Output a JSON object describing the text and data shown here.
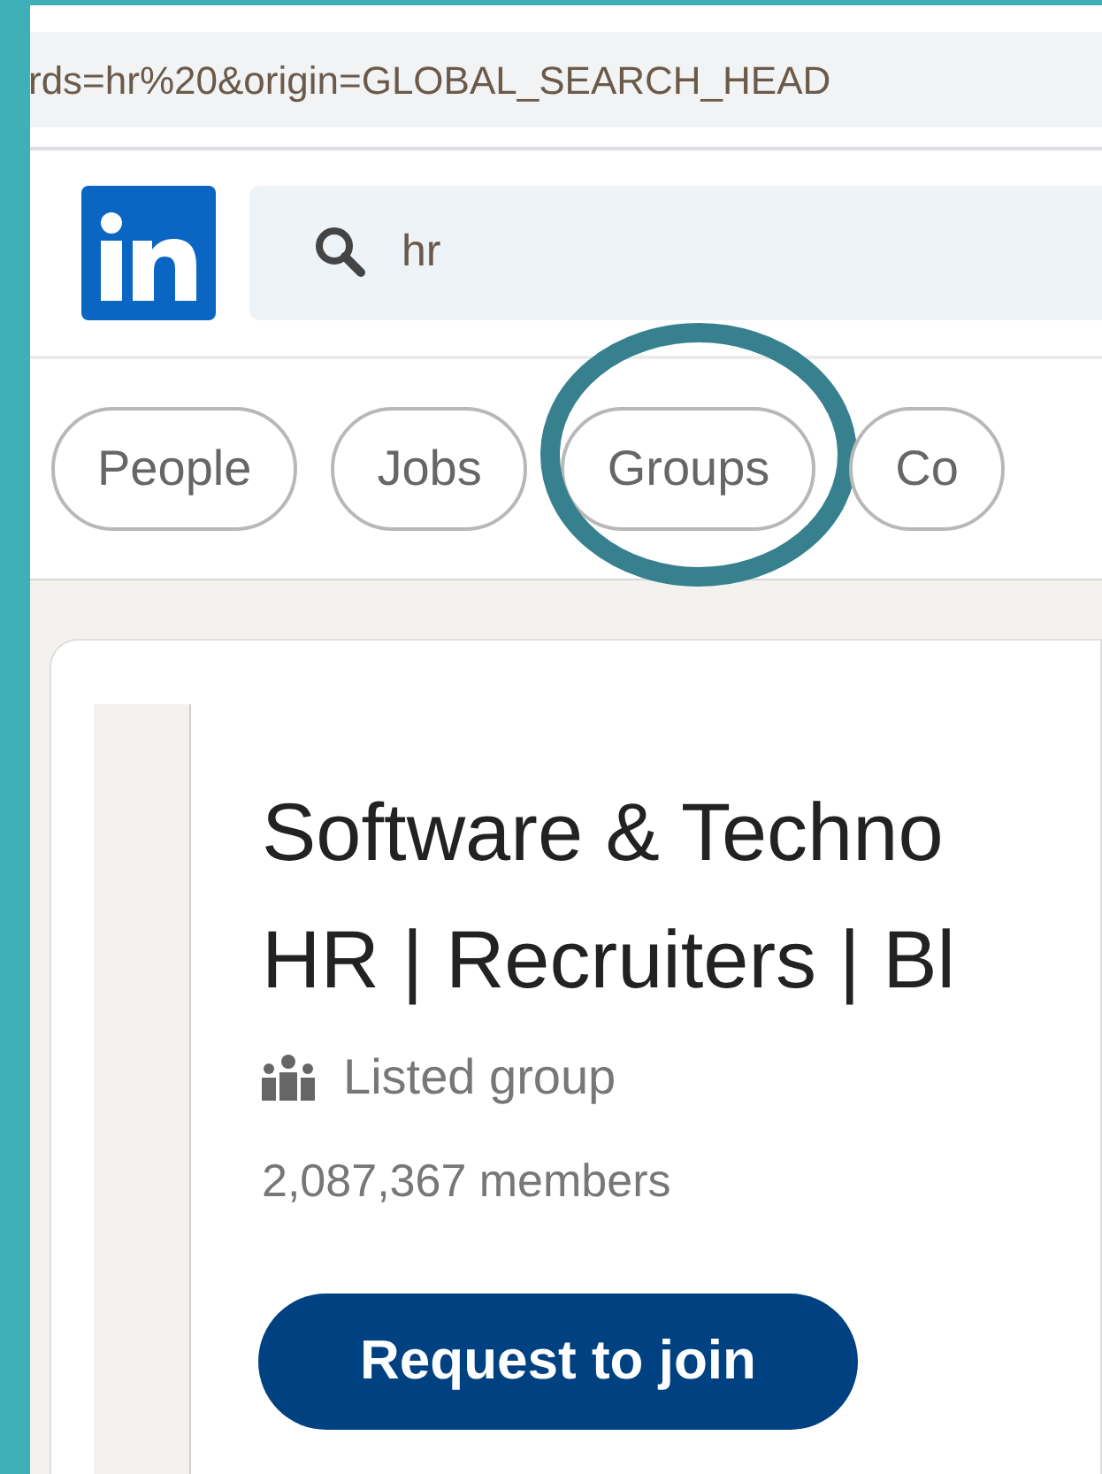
{
  "address_bar": {
    "url": "rds=hr%20&origin=GLOBAL_SEARCH_HEAD"
  },
  "search": {
    "value": "hr"
  },
  "filters": [
    {
      "label": "People",
      "highlighted": false
    },
    {
      "label": "Jobs",
      "highlighted": false
    },
    {
      "label": "Groups",
      "highlighted": true
    },
    {
      "label": "Co",
      "highlighted": false
    }
  ],
  "group": {
    "title_lines": [
      "Software & Techno",
      "HR | Recruiters | Bl"
    ],
    "visibility": "Listed group",
    "members": "2,087,367 members",
    "button": "Request to join"
  }
}
